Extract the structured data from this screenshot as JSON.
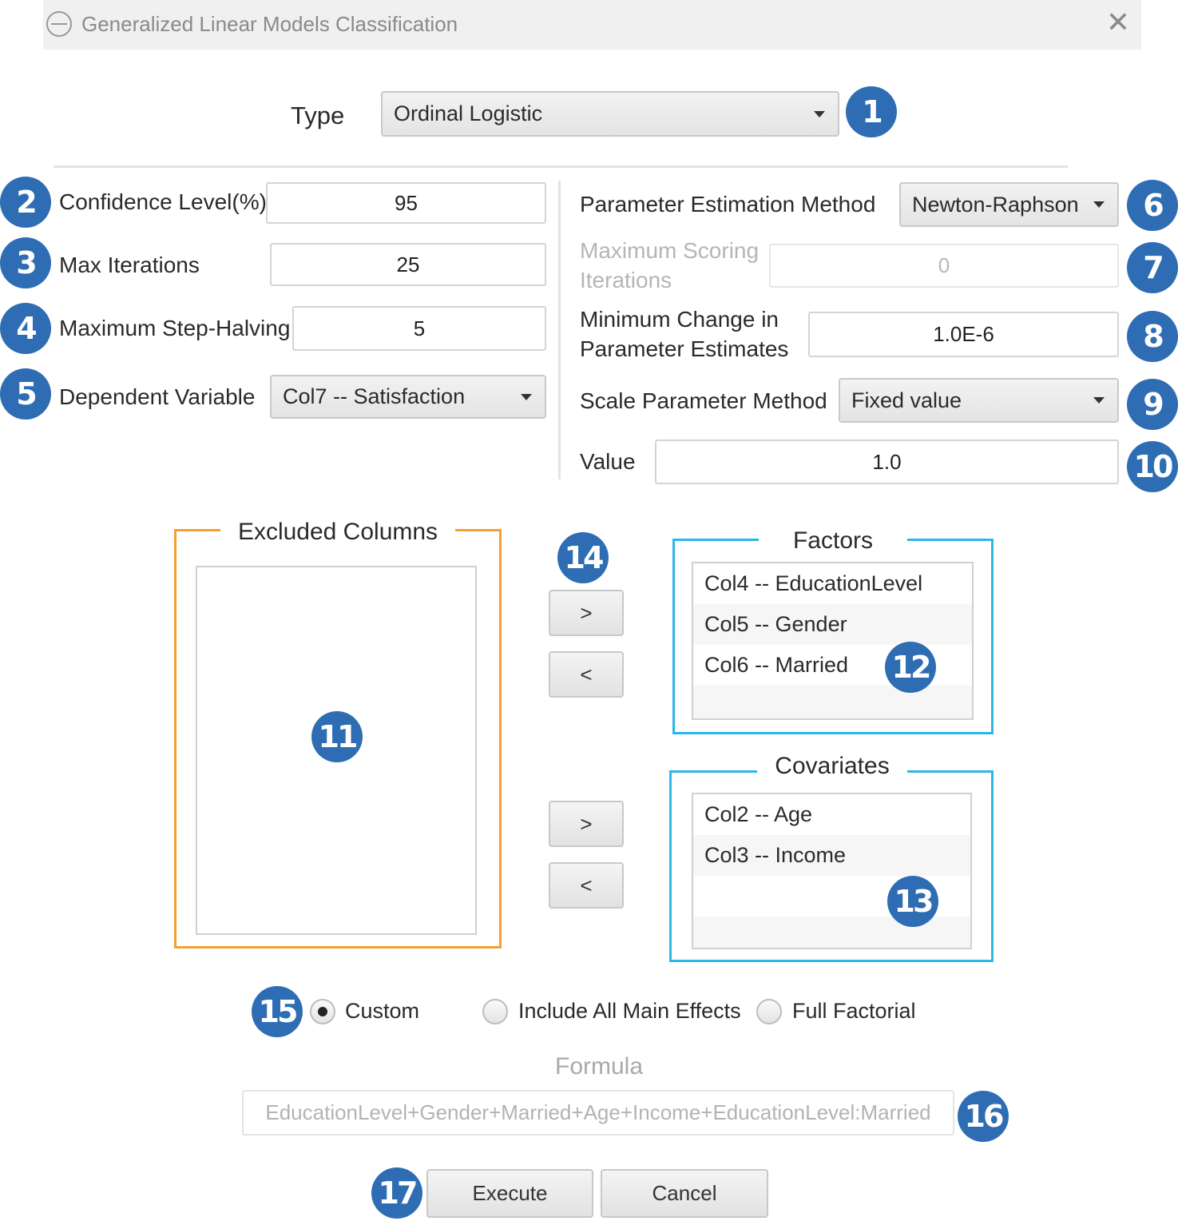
{
  "window": {
    "title": "Generalized Linear Models Classification",
    "icon": "app-icon",
    "close_icon": "close-icon",
    "close_glyph": "✕"
  },
  "type": {
    "label": "Type",
    "value": "Ordinal Logistic"
  },
  "left_panel": {
    "confidence_level": {
      "label": "Confidence Level(%)",
      "value": "95"
    },
    "max_iterations": {
      "label": "Max Iterations",
      "value": "25"
    },
    "max_step_halving": {
      "label": "Maximum Step-Halving",
      "value": "5"
    },
    "dependent_variable": {
      "label": "Dependent Variable",
      "value": "Col7 -- Satisfaction"
    }
  },
  "right_panel": {
    "param_estimation_method": {
      "label": "Parameter Estimation Method",
      "value": "Newton-Raphson"
    },
    "max_scoring_iterations": {
      "label": "Maximum Scoring Iterations",
      "value": "0",
      "disabled": true
    },
    "min_change": {
      "label": "Minimum Change in Parameter Estimates",
      "value": "1.0E-6"
    },
    "scale_param_method": {
      "label": "Scale Parameter Method",
      "value": "Fixed value"
    },
    "value": {
      "label": "Value",
      "value": "1.0"
    }
  },
  "excluded_columns": {
    "title": "Excluded Columns",
    "items": []
  },
  "factors": {
    "title": "Factors",
    "items": [
      "Col4 -- EducationLevel",
      "Col5 -- Gender",
      "Col6 -- Married"
    ]
  },
  "covariates": {
    "title": "Covariates",
    "items": [
      "Col2 -- Age",
      "Col3 -- Income"
    ]
  },
  "move_buttons": {
    "add_factor": ">",
    "remove_factor": "<",
    "add_covariate": ">",
    "remove_covariate": "<"
  },
  "model_options": {
    "selected": "Custom",
    "options": [
      "Custom",
      "Include All Main Effects",
      "Full Factorial"
    ]
  },
  "formula": {
    "label": "Formula",
    "value": "EducationLevel+Gender+Married+Age+Income+EducationLevel:Married"
  },
  "actions": {
    "execute": "Execute",
    "cancel": "Cancel"
  },
  "badges": [
    "1",
    "2",
    "3",
    "4",
    "5",
    "6",
    "7",
    "8",
    "9",
    "10",
    "11",
    "12",
    "13",
    "14",
    "15",
    "16",
    "17"
  ],
  "colors": {
    "badge": "#2e6db4",
    "excluded_border": "#f5a030",
    "factors_border": "#2cb7e8"
  }
}
